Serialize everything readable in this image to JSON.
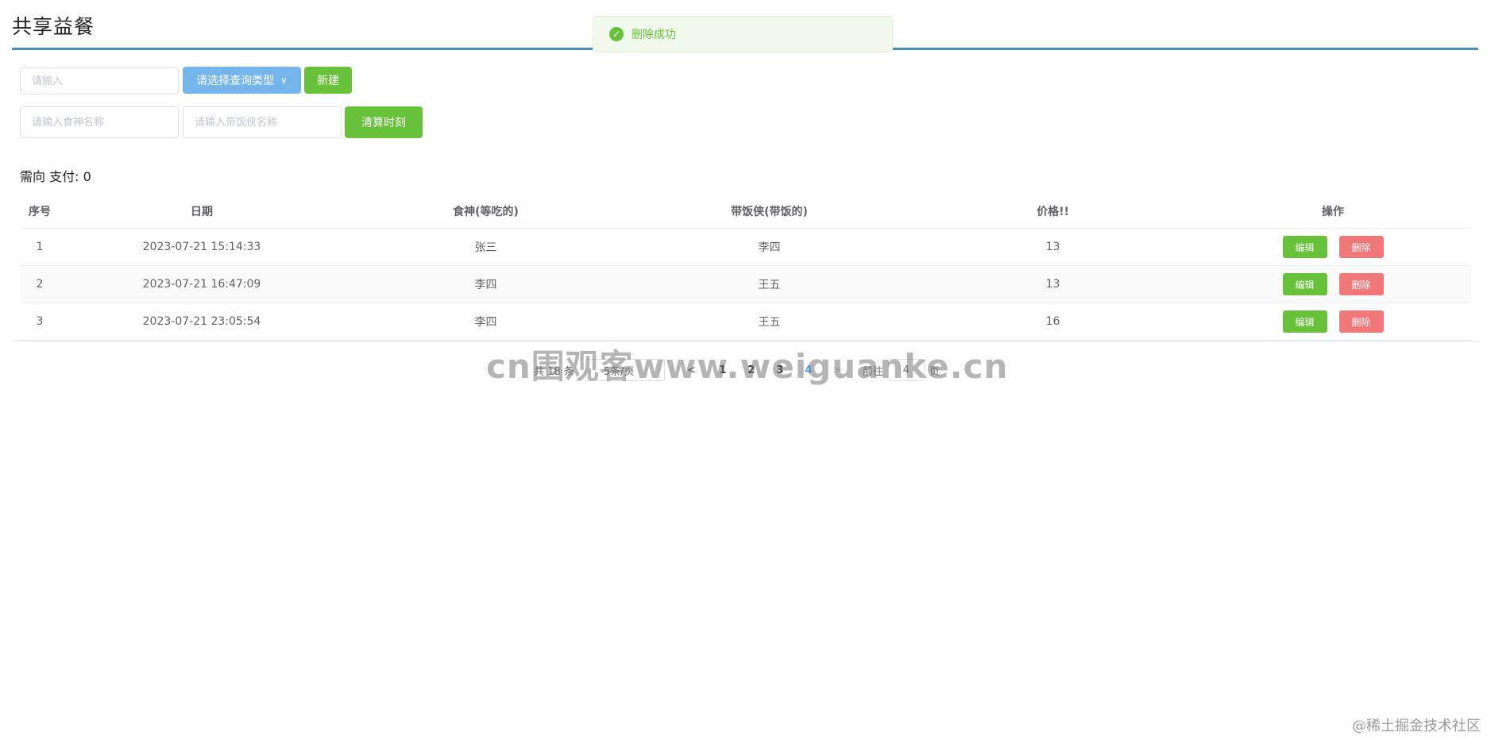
{
  "page": {
    "title": "共享益餐"
  },
  "toast": {
    "message": "删除成功",
    "icon": "check-circle-icon",
    "color": "#67c23a"
  },
  "search": {
    "keyword_placeholder": "请输入",
    "type_select_label": "请选择查询类型",
    "new_button": "新建",
    "food_placeholder": "请输入食神名称",
    "carrier_placeholder": "请输入带饭侠名称",
    "settle_button": "清算时刻"
  },
  "balance": {
    "text": "需向 支付: 0"
  },
  "table": {
    "headers": [
      "序号",
      "日期",
      "食神(等吃的)",
      "带饭侠(带饭的)",
      "价格!!",
      "操作"
    ],
    "rows": [
      {
        "index": "1",
        "date": "2023-07-21 15:14:33",
        "eater": "张三",
        "carrier": "李四",
        "price": "13"
      },
      {
        "index": "2",
        "date": "2023-07-21 16:47:09",
        "eater": "李四",
        "carrier": "王五",
        "price": "13"
      },
      {
        "index": "3",
        "date": "2023-07-21 23:05:54",
        "eater": "李四",
        "carrier": "王五",
        "price": "16"
      }
    ],
    "edit_label": "编辑",
    "delete_label": "删除"
  },
  "pagination": {
    "total_text": "共 18 条",
    "page_size": "5条/页",
    "prev": "<",
    "pages": [
      "1",
      "2",
      "3",
      "4"
    ],
    "current": "4",
    "next": ">",
    "goto_prefix": "前往",
    "goto_value": "4",
    "goto_suffix": "页"
  },
  "overlays": {
    "watermark": "cn围观客www.weiguanke.cn",
    "corner": "@稀土掘金技术社区"
  },
  "colors": {
    "primary_green": "#67c23a",
    "danger_red": "#f56c6c",
    "select_blue": "#74b6ec",
    "title_rule": "#4a8db6",
    "active_page": "#409eff"
  }
}
